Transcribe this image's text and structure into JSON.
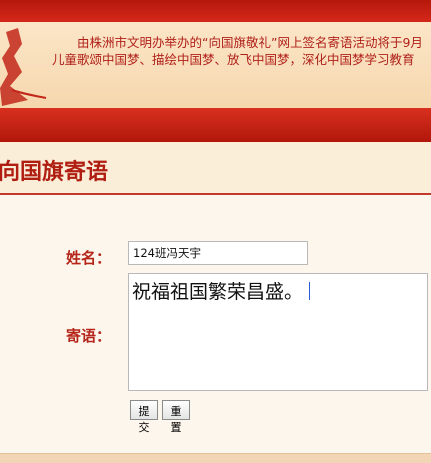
{
  "notice": {
    "line1": "由株洲市文明办举办的“向国旗敬礼”网上签名寄语活动将于9月",
    "line2": "儿童歌颂中国梦、描绘中国梦、放飞中国梦，深化中国梦学习教育"
  },
  "section": {
    "title": "向国旗寄语"
  },
  "form": {
    "name_label": "姓名：",
    "name_value": "124班冯天宇",
    "message_label": "寄语：",
    "message_value": "祝福祖国繁荣昌盛。",
    "submit_label": "提交",
    "reset_label": "重置"
  },
  "colors": {
    "accent_red": "#b01e12",
    "banner_bg": "#fbe6c7",
    "page_bg": "#fdf6ec"
  }
}
